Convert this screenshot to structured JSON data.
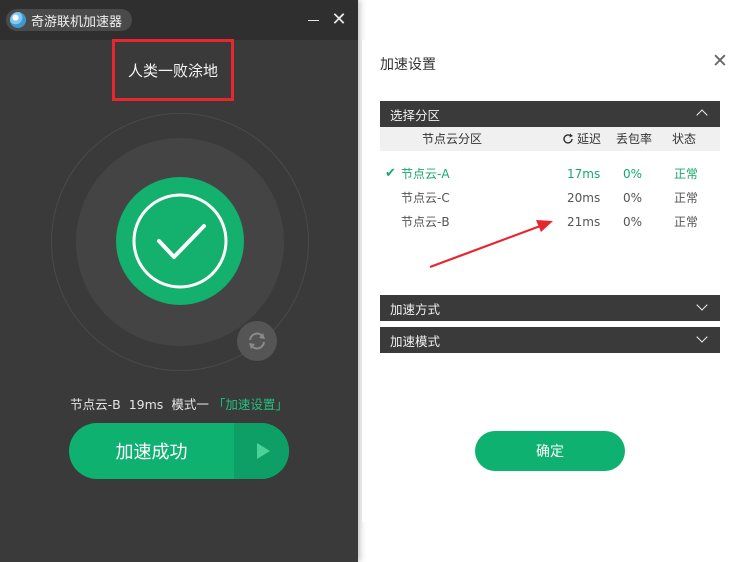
{
  "app": {
    "title": "奇游联机加速器",
    "game_name": "人类一败涂地",
    "status": {
      "node": "节点云-B",
      "latency": "19ms",
      "mode": "模式一",
      "settings_link": "「加速设置」"
    },
    "accelerate_button": "加速成功"
  },
  "settings": {
    "title": "加速设置",
    "zone_section": "选择分区",
    "columns": {
      "node": "节点云分区",
      "latency": "延迟",
      "loss": "丢包率",
      "status": "状态"
    },
    "zones": [
      {
        "name": "节点云-A",
        "latency": "17ms",
        "loss": "0%",
        "status": "正常",
        "selected": true
      },
      {
        "name": "节点云-C",
        "latency": "20ms",
        "loss": "0%",
        "status": "正常",
        "selected": false
      },
      {
        "name": "节点云-B",
        "latency": "21ms",
        "loss": "0%",
        "status": "正常",
        "selected": false
      }
    ],
    "method_section": "加速方式",
    "mode_section": "加速模式",
    "confirm_button": "确定"
  },
  "colors": {
    "accent": "#0fb170",
    "annotation": "#e8262e",
    "dark_bg": "#3a3a3a"
  },
  "icons": [
    "app-logo-icon",
    "minimize-icon",
    "close-icon",
    "checkmark-icon",
    "refresh-icon",
    "play-icon",
    "chevron-up-icon",
    "chevron-down-icon",
    "refresh-small-icon",
    "check-icon"
  ]
}
